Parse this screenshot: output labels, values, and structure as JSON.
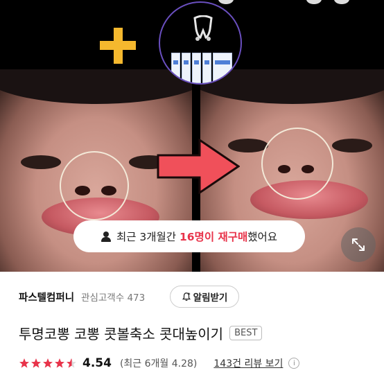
{
  "banner": {
    "prefix": "최근 3개월간",
    "highlight": "16명이 재구매",
    "suffix": "했어요"
  },
  "seller": {
    "name": "파스텔컴퍼니",
    "followers_label": "관심고객수 473",
    "follow_button": "알림받기"
  },
  "product": {
    "title": "투명코뽕 코뽕 콧볼축소 콧대높이기",
    "badge": "BEST"
  },
  "rating": {
    "stars": 4.5,
    "score": "4.54",
    "recent": "(최근 6개월 4.28)",
    "reviews_link": "143건 리뷰 보기",
    "info": "i"
  },
  "colors": {
    "highlight": "#e8334a",
    "plus": "#f5b82e",
    "arrow": "#f0505a",
    "circle_border": "#6a4fbf"
  },
  "icons": [
    "plus-icon",
    "arrow-right-icon",
    "person-icon",
    "expand-icon",
    "bell-plus-icon",
    "star-icon",
    "info-icon"
  ]
}
